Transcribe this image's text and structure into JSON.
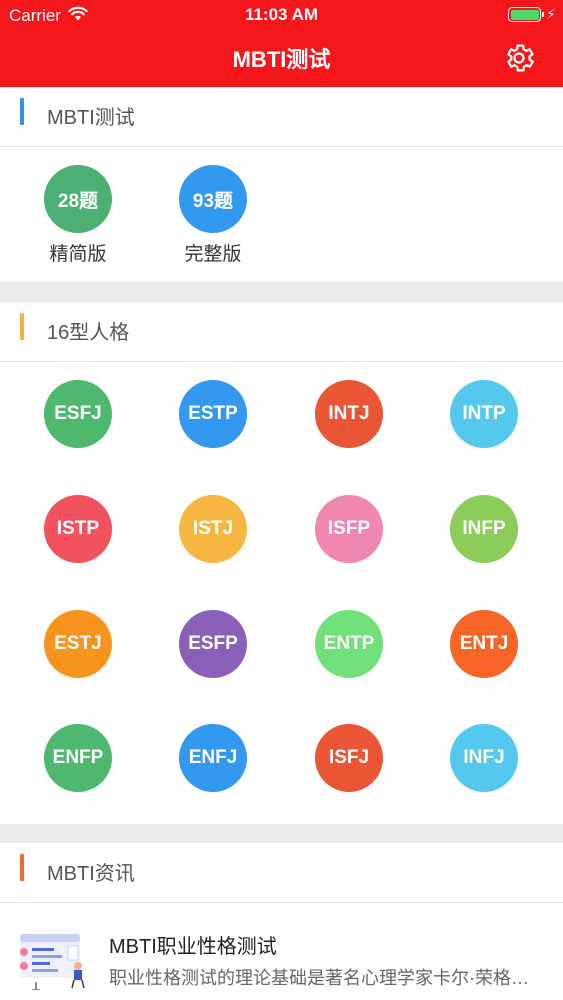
{
  "status": {
    "carrier": "Carrier",
    "time": "11:03 AM",
    "battery_color": "#4cd964",
    "icons": [
      "wifi-icon",
      "battery-icon",
      "charging-bolt-icon"
    ]
  },
  "nav": {
    "title": "MBTI测试",
    "background": "#f5161b",
    "settings_icon": "gear-icon"
  },
  "test_section": {
    "title": "MBTI测试",
    "accent": "#3a8ee6",
    "tests": [
      {
        "badge": "28题",
        "label": "精简版",
        "color": "#4caf73"
      },
      {
        "badge": "93题",
        "label": "完整版",
        "color": "#3399f0"
      }
    ]
  },
  "types_section": {
    "title": "16型人格",
    "accent": "#f2b440",
    "types": [
      {
        "label": "ESFJ",
        "color": "#4db86e"
      },
      {
        "label": "ESTP",
        "color": "#3399f0"
      },
      {
        "label": "INTJ",
        "color": "#ea5535"
      },
      {
        "label": "INTP",
        "color": "#55c8ee"
      },
      {
        "label": "ISTP",
        "color": "#f2515e"
      },
      {
        "label": "ISTJ",
        "color": "#f5b642"
      },
      {
        "label": "ISFP",
        "color": "#f087ae"
      },
      {
        "label": "INFP",
        "color": "#8ccd5a"
      },
      {
        "label": "ESTJ",
        "color": "#f7941d"
      },
      {
        "label": "ESFP",
        "color": "#8a5fb8"
      },
      {
        "label": "ENTP",
        "color": "#6fe07a"
      },
      {
        "label": "ENTJ",
        "color": "#f66525"
      },
      {
        "label": "ENFP",
        "color": "#4db86e"
      },
      {
        "label": "ENFJ",
        "color": "#3399f0"
      },
      {
        "label": "ISFJ",
        "color": "#ea5535"
      },
      {
        "label": "INFJ",
        "color": "#55c8ee"
      }
    ]
  },
  "news_section": {
    "title": "MBTI资讯",
    "accent": "#f06a2a",
    "items": [
      {
        "title": "MBTI职业性格测试",
        "snippet": "职业性格测试的理论基础是著名心理学家卡尔·荣格的心理类型理论",
        "thumb_icon": "career-illustration-icon"
      }
    ]
  }
}
